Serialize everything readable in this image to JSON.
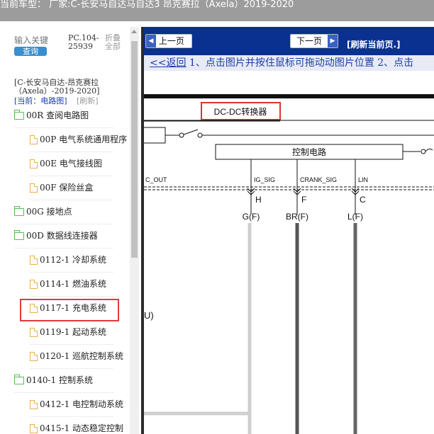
{
  "header": {
    "title": "当前车型： 厂家:C-长安马自达马自达3 昂克赛拉（Axela）2019-2020"
  },
  "sidebar": {
    "search_placeholder": "输入关键",
    "search_button": "查询",
    "pc_code": "PC.104-25939",
    "collapse_all": "折叠全部",
    "car_title": "[C-长安马自达-昂克赛拉（Axela）-2019-2020]",
    "current_label": "[当前：电路图]",
    "refresh_label": "[刷新]",
    "items": [
      {
        "label": "00R 查阅电路图",
        "type": "folder"
      },
      {
        "label": "00P 电气系统通用程序",
        "type": "file"
      },
      {
        "label": "00E 电气接线图",
        "type": "file"
      },
      {
        "label": "00F 保险丝盒",
        "type": "file"
      },
      {
        "label": "00G 接地点",
        "type": "folder"
      },
      {
        "label": "00D 数据线连接器",
        "type": "folder"
      },
      {
        "label": "0112-1 冷却系统",
        "type": "file"
      },
      {
        "label": "0114-1 燃油系统",
        "type": "file"
      },
      {
        "label": "0117-1 充电系统",
        "type": "file"
      },
      {
        "label": "0119-1 起动系统",
        "type": "file"
      },
      {
        "label": "0120-1 巡航控制系统",
        "type": "file"
      },
      {
        "label": "0140-1 控制系统",
        "type": "folder"
      },
      {
        "label": "0412-1 电控制动系统",
        "type": "file"
      },
      {
        "label": "0415-1 动态稳定控制",
        "type": "file"
      }
    ]
  },
  "main": {
    "prev_page": "上一页",
    "next_page": "下一页",
    "refresh_page": "[刷新当前页.]",
    "back_link": "<<返回",
    "instruction": "1、点击图片并按住鼠标可拖动动图片位置 2、点击",
    "diagram": {
      "converter_label": "DC-DC转换器",
      "control_label": "控制电路",
      "pins": [
        {
          "signal": "C_OUT",
          "letter": "",
          "wire": ""
        },
        {
          "signal": "IG_SIG",
          "letter": "H",
          "wire": "G(F)"
        },
        {
          "signal": "CRANK_SIG",
          "letter": "F",
          "wire": "BR(F)"
        },
        {
          "signal": "LIN",
          "letter": "C",
          "wire": "L(F)"
        }
      ],
      "side_label": "U)"
    }
  },
  "colors": {
    "nav_bg": "#0a318f",
    "highlight": "#e23a3a",
    "header_bg": "#9c9c9c"
  }
}
